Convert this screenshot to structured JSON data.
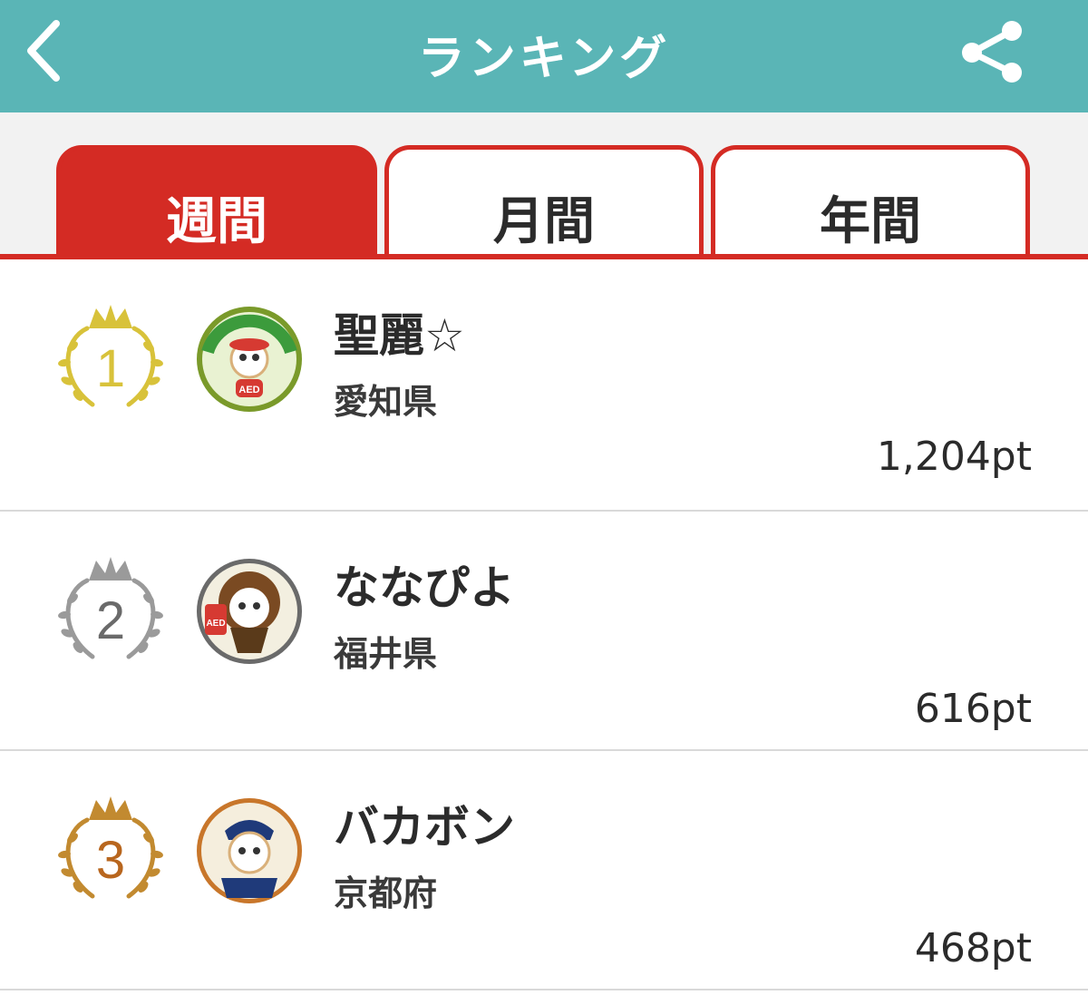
{
  "header": {
    "title": "ランキング",
    "back_icon": "chevron-left-icon",
    "share_icon": "share-icon",
    "bg_color": "#5ab5b6"
  },
  "tabs": [
    {
      "label": "週間",
      "active": true
    },
    {
      "label": "月間",
      "active": false
    },
    {
      "label": "年間",
      "active": false
    }
  ],
  "accent_color": "#d42b24",
  "ranking": [
    {
      "rank": "1",
      "name": "聖麗☆",
      "prefecture": "愛知県",
      "points": "1,204pt",
      "medal_color": "#d8c23a",
      "avatar_text": "AED"
    },
    {
      "rank": "2",
      "name": "ななぴよ",
      "prefecture": "福井県",
      "points": "616pt",
      "medal_color": "#9a9a9a",
      "avatar_text": "AED"
    },
    {
      "rank": "3",
      "name": "バカボン",
      "prefecture": "京都府",
      "points": "468pt",
      "medal_color": "#c28a30",
      "avatar_text": ""
    }
  ]
}
